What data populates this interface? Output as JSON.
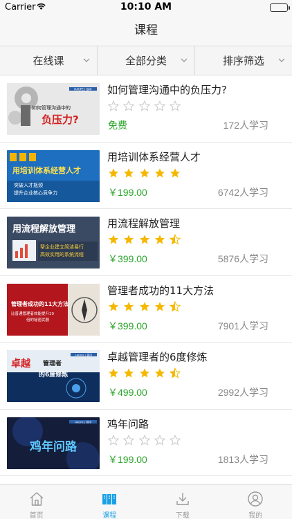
{
  "status_bar": {
    "carrier": "Carrier",
    "time": "10:10 AM"
  },
  "nav": {
    "title": "课程"
  },
  "filters": [
    {
      "label": "在线课"
    },
    {
      "label": "全部分类"
    },
    {
      "label": "排序筛选"
    }
  ],
  "colors": {
    "price": "#2aa52a",
    "star_filled": "#f5b800",
    "star_empty": "#c8c8c8",
    "tab_active": "#1aa0e6"
  },
  "courses": [
    {
      "title": "如何管理沟通中的负压力?",
      "rating": 0,
      "price": "免费",
      "learners": "172人学习",
      "thumb_text": [
        "如何管理沟通中的",
        "负压力?"
      ],
      "thumb_brand": "HAUFE | 锐中"
    },
    {
      "title": "用培训体系经营人才",
      "rating": 5,
      "price": "￥199.00",
      "learners": "6742人学习",
      "thumb_text": [
        "用培训体系经营人才",
        "突破人才瓶颈",
        "提升企业核心竞争力"
      ]
    },
    {
      "title": "用流程解放管理",
      "rating": 4.5,
      "price": "￥399.00",
      "learners": "5876人学习",
      "thumb_text": [
        "用流程解放管理",
        "帮企业建立简洁易行",
        "高效实用的系统流程"
      ]
    },
    {
      "title": "管理者成功的11大方法",
      "rating": 4.5,
      "price": "￥399.00",
      "learners": "7901人学习",
      "thumb_text": [
        "管理者成功的11大方法",
        "比普通管理者效能提升10",
        "倍的秘密武器"
      ]
    },
    {
      "title": "卓越管理者的6度修炼",
      "rating": 4.5,
      "price": "￥499.00",
      "learners": "2992人学习",
      "thumb_text": [
        "卓越",
        "管理者",
        "的6度修炼"
      ],
      "thumb_brand": "HAUFE | 锐中"
    },
    {
      "title": "鸡年问路",
      "rating": 0,
      "price": "￥199.00",
      "learners": "1813人学习",
      "thumb_text": [
        "鸡年问路"
      ],
      "thumb_brand": "HAUFE | 锐中"
    }
  ],
  "tabs": [
    {
      "label": "首页",
      "icon": "home-icon",
      "active": false
    },
    {
      "label": "课程",
      "icon": "course-list-icon",
      "active": true
    },
    {
      "label": "下载",
      "icon": "download-icon",
      "active": false
    },
    {
      "label": "我的",
      "icon": "profile-icon",
      "active": false
    }
  ]
}
